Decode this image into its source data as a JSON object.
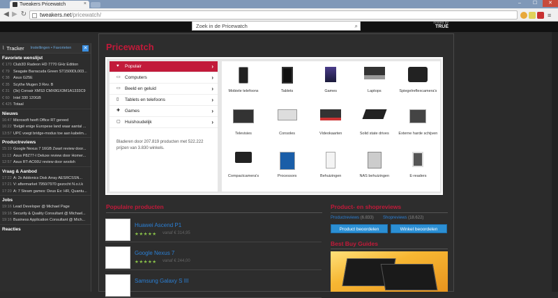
{
  "browser": {
    "tab_title": "Tweakers Pricewatch",
    "tab_close": "×",
    "url_host": "tweakers.net",
    "url_path": "/pricewatch/",
    "min": "–",
    "max": "☐",
    "close": "✕"
  },
  "site": {
    "search_placeholder": "Zoek in de Pricewatch",
    "hosted_by": "hosted by",
    "hosted_brand": "TRUE"
  },
  "tracker": {
    "title": "Tracker",
    "links": "Instellingen • Favorieten",
    "close": "✕",
    "sections": [
      {
        "title": "Favoriete wenslijst",
        "rows": [
          {
            "k": "€ 170",
            "v": "Club3D Radeon HD 7770 GHz Edition"
          },
          {
            "k": "€ 79",
            "v": "Seagate Barracuda Green ST1500DL003..."
          },
          {
            "k": "€ 38",
            "v": "Asus G25E"
          },
          {
            "k": "€ 35",
            "v": "Scythe Mugen 3 Rev. B"
          },
          {
            "k": "€ 31",
            "v": "(3x) Corsair XMS3 CMX8GX3M1A1333C9"
          },
          {
            "k": "€ 60",
            "v": "Intel 330 120GB"
          },
          {
            "k": "€ 425",
            "v": "Totaal"
          }
        ]
      },
      {
        "title": "Nieuws",
        "rows": [
          {
            "k": "16:47",
            "v": "Microsoft heeft Office RT gereed"
          },
          {
            "k": "16:22",
            "v": "'België enige Europese land waar aantal ..."
          },
          {
            "k": "13:57",
            "v": "UPC voegt bridge-modus toe aan kabelm..."
          }
        ]
      },
      {
        "title": "Productreviews",
        "rows": [
          {
            "k": "15:19",
            "v": "Google Nexus 7 16GB Zwart review door..."
          },
          {
            "k": "11:13",
            "v": "Asus P8Z77-I Deluxe review door Homer..."
          },
          {
            "k": "12:57",
            "v": "Asus RT-AC66U review door woolsh"
          }
        ]
      },
      {
        "title": "Vraag & Aanbod",
        "rows": [
          {
            "k": "17:22",
            "v": "A: 2x Addonics Disk Array AESRCSSN..."
          },
          {
            "k": "17:21",
            "v": "V: aftermarket 7950/7970 gezocht N.o.t.k"
          },
          {
            "k": "17:20",
            "v": "A: 7 Steam games: Deus Ex: HR, Quantu..."
          }
        ]
      },
      {
        "title": "Jobs",
        "rows": [
          {
            "k": "19:16",
            "v": "Lead Developer @ Michael Page"
          },
          {
            "k": "19:16",
            "v": "Security & Quality Consultant @ Michael..."
          },
          {
            "k": "19:16",
            "v": "Business Application Consultant @ Mich..."
          }
        ]
      },
      {
        "title": "Reacties",
        "rows": []
      }
    ]
  },
  "pricewatch": {
    "title": "Pricewatch",
    "categories": [
      "Populair",
      "Computers",
      "Beeld en geluid",
      "Tablets en telefoons",
      "Games",
      "Huishoudelijk"
    ],
    "desc": "Bladeren door 207.819 producten met 522.222 prijzen van 3.830 winkels.",
    "grid": [
      "Mobiele telefoons",
      "Tablets",
      "Games",
      "Laptops",
      "Spiegelreflexcamera's",
      "Televisies",
      "Consoles",
      "Videokaarten",
      "Solid state drives",
      "Externe harde schijven",
      "Compactcamera's",
      "Processors",
      "Behuizingen",
      "NAS behuizingen",
      "E-readers"
    ]
  },
  "popular": {
    "title": "Populaire producten",
    "items": [
      {
        "name": "Huawei Ascend P1",
        "price": "vanaf € 314,95"
      },
      {
        "name": "Google Nexus 7",
        "price": "vanaf € 244,00"
      },
      {
        "name": "Samsung Galaxy S III",
        "price": ""
      }
    ],
    "stars": "★★★★★"
  },
  "reviews": {
    "title": "Product- en shopreviews",
    "product_label": "Productreviews",
    "product_count": "(6.833)",
    "shop_label": "Shopreviews",
    "shop_count": "(18.622)",
    "btn_product": "Product beoordelen",
    "btn_shop": "Winkel beoordelen"
  },
  "bbg": {
    "title": "Best Buy Guides"
  }
}
